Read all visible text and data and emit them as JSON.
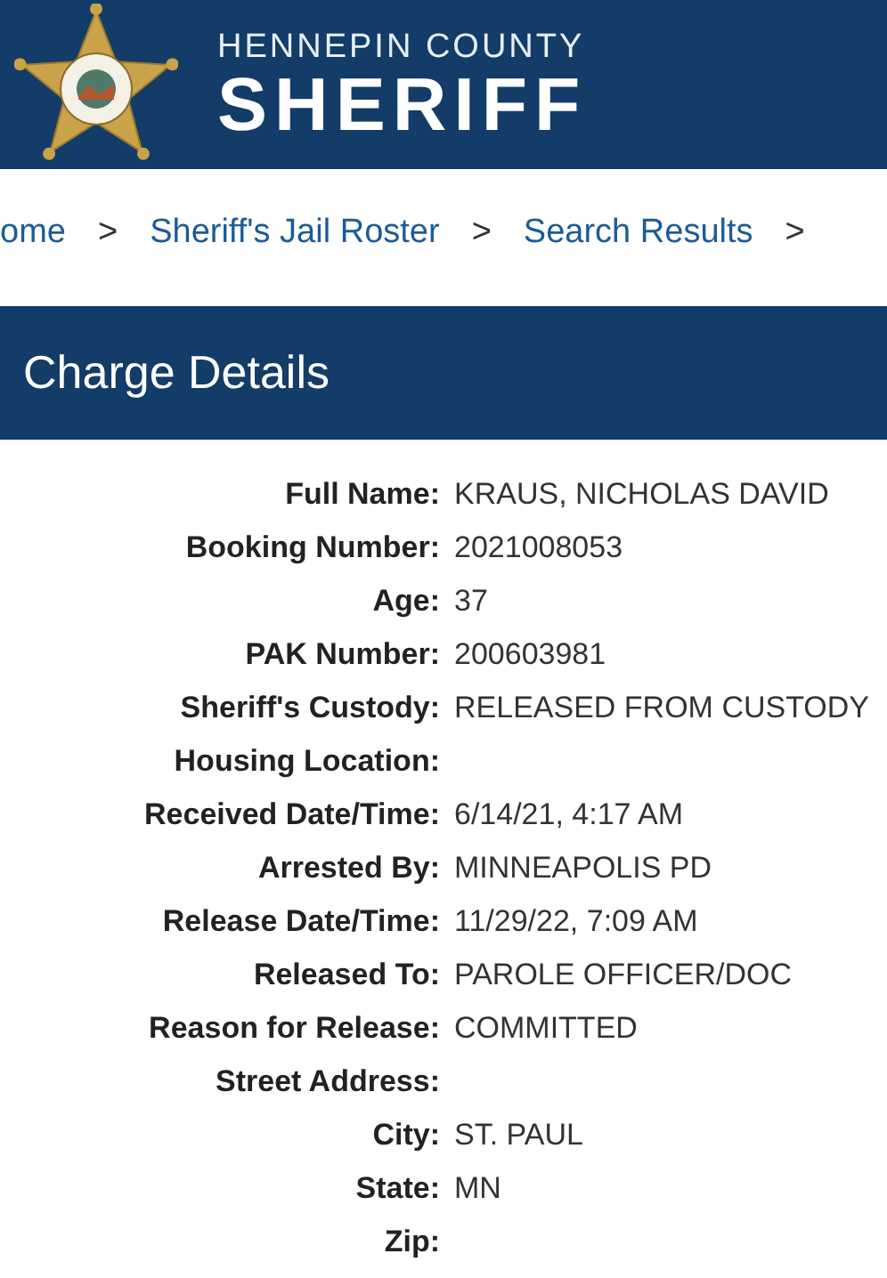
{
  "header": {
    "county": "HENNEPIN COUNTY",
    "title": "SHERIFF"
  },
  "breadcrumb": [
    {
      "label": "ome",
      "kind": "link"
    },
    {
      "label": ">",
      "kind": "sep"
    },
    {
      "label": "Sheriff's Jail Roster",
      "kind": "link"
    },
    {
      "label": ">",
      "kind": "sep"
    },
    {
      "label": "Search Results",
      "kind": "link"
    },
    {
      "label": ">",
      "kind": "sep"
    }
  ],
  "section": {
    "title": "Charge Details"
  },
  "details": [
    {
      "label": "Full Name:",
      "value": "KRAUS, NICHOLAS DAVID"
    },
    {
      "label": "Booking Number:",
      "value": "2021008053"
    },
    {
      "label": "Age:",
      "value": "37"
    },
    {
      "label": "PAK Number:",
      "value": "200603981"
    },
    {
      "label": "Sheriff's Custody:",
      "value": "RELEASED FROM CUSTODY"
    },
    {
      "label": "Housing Location:"
    },
    {
      "label": "Received Date/Time:",
      "value": "6/14/21, 4:17 AM"
    },
    {
      "label": "Arrested By:",
      "value": "MINNEAPOLIS PD"
    },
    {
      "label": "Release Date/Time:",
      "value": "11/29/22, 7:09 AM"
    },
    {
      "label": "Released To:",
      "value": "PAROLE OFFICER/DOC"
    },
    {
      "label": "Reason for Release:",
      "value": "COMMITTED"
    },
    {
      "label": "Street Address:"
    },
    {
      "label": "City:",
      "value": "ST. PAUL"
    },
    {
      "label": "State:",
      "value": "MN"
    },
    {
      "label": "Zip:"
    }
  ]
}
